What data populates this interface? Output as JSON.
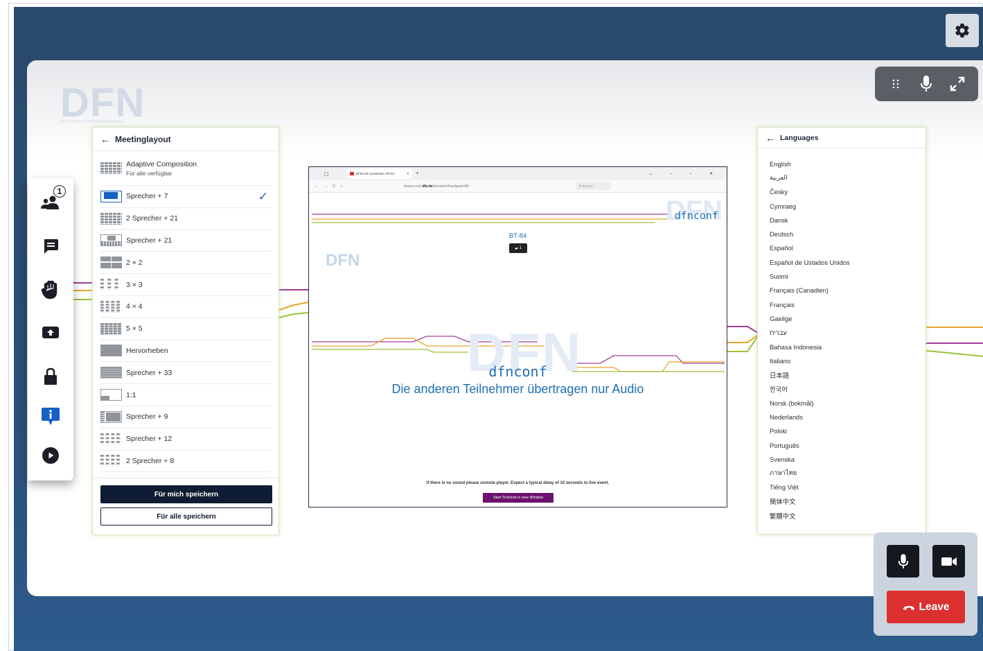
{
  "brand": {
    "logo_text": "DFN",
    "logo_subtext": "DEUTSCHES FORSCHUNGSNETZ"
  },
  "icons": {
    "settings": "gear-icon",
    "drag": "drag-handle-icon",
    "mic": "microphone-icon",
    "fullscreen": "expand-icon",
    "participants": "participants-icon",
    "chat": "chat-icon",
    "hand": "raise-hand-icon",
    "share": "screen-share-icon",
    "lock": "lock-icon",
    "info": "info-icon",
    "play": "play-icon",
    "camera": "camera-icon",
    "hangup": "phone-hangup-icon"
  },
  "sidebar": {
    "participants_count": "1"
  },
  "layout_panel": {
    "title": "Meetinglayout",
    "items": [
      {
        "label": "Adaptive Composition",
        "sub": "Für alle verfügbar"
      },
      {
        "label": "Sprecher + 7",
        "selected": true
      },
      {
        "label": "2 Sprecher + 21"
      },
      {
        "label": "Sprecher + 21"
      },
      {
        "label": "2 × 2"
      },
      {
        "label": "3 × 3"
      },
      {
        "label": "4 × 4"
      },
      {
        "label": "5 × 5"
      },
      {
        "label": "Hervorheben"
      },
      {
        "label": "Sprecher + 33"
      },
      {
        "label": "1:1"
      },
      {
        "label": "Sprecher + 9"
      },
      {
        "label": "Sprecher + 12"
      },
      {
        "label": "2 Sprecher + 8"
      }
    ],
    "save_me": "Für mich speichern",
    "save_all": "Für alle speichern"
  },
  "languages_panel": {
    "title": "Languages",
    "items": [
      "English",
      "العربية",
      "Česky",
      "Cymraeg",
      "Dansk",
      "Deutsch",
      "Español",
      "Español de Ustados Unidos",
      "Suomi",
      "Français (Canadien)",
      "Français",
      "Gaeilge",
      "עברית",
      "Bahasa Indonesia",
      "Italiano",
      "日本語",
      "한국어",
      "Norsk (bokmål)",
      "Nederlands",
      "Polski",
      "Português",
      "Svenska",
      "ภาษาไทย",
      "Tiếng Việt",
      "簡体中文",
      "繁體中文"
    ]
  },
  "video": {
    "tab_title": "DFNconf Livestream: BT-84",
    "url_prefix": "stream.conf.",
    "url_domain": "dfn.de",
    "url_path": "/stream/m5opdguztm8h",
    "search_placeholder": "Suchen",
    "logo_brand": "dfnconf",
    "logo_ghost": "DFN",
    "room": "BT-84",
    "cam_count": "1",
    "message": "Die anderen Teilnehmer übertragen nur Audio",
    "note": "If there is no sound please unmute player. Expect a typical delay of 10 seconds to live event.",
    "textchat_button": "Start Textchat in new Window"
  },
  "controls": {
    "leave": "Leave"
  },
  "colors": {
    "header": "#2a4a6c",
    "leave": "#dc2f2f",
    "accent": "#1561c5",
    "brand_blue": "#1d6fb5",
    "line_purple": "#a23b9a",
    "line_orange": "#e8a32a",
    "line_green": "#9cc23a"
  }
}
